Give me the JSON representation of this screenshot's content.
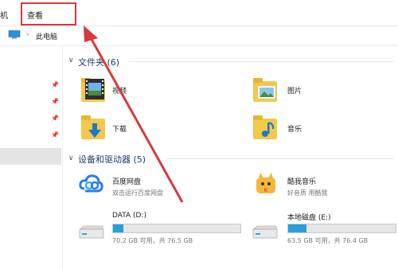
{
  "ribbon": {
    "tab_computer_partial": "机",
    "tab_view": "查看"
  },
  "address": {
    "sep": "›",
    "breadcrumb": "此电脑"
  },
  "folders_group": {
    "title": "文件夹 (6)",
    "items": [
      {
        "label": "视频",
        "icon": "video-folder-icon"
      },
      {
        "label": "图片",
        "icon": "pictures-folder-icon"
      },
      {
        "label": "下载",
        "icon": "downloads-folder-icon"
      },
      {
        "label": "音乐",
        "icon": "music-folder-icon"
      }
    ]
  },
  "devices_group": {
    "title": "设备和驱动器 (5)",
    "apps": [
      {
        "label": "百度网盘",
        "sub": "双击运行百度网盘",
        "icon": "baidu-netdisk-icon"
      },
      {
        "label": "酷我音乐",
        "sub": "好音质 用酷我",
        "icon": "kuwo-music-icon"
      }
    ],
    "drives": [
      {
        "label": "DATA (D:)",
        "sub": "70.2 GB 可用，共 76.5 GB",
        "used_fraction": 0.082,
        "icon": "hard-drive-icon"
      },
      {
        "label": "本地磁盘 (E:)",
        "sub": "63.5 GB 可用，共 76.4 GB",
        "used_fraction": 0.169,
        "icon": "hard-drive-icon"
      }
    ]
  },
  "colors": {
    "annotation": "#d93a3a",
    "drive_fill": "#26a0da",
    "group_header": "#1e3a6d"
  }
}
